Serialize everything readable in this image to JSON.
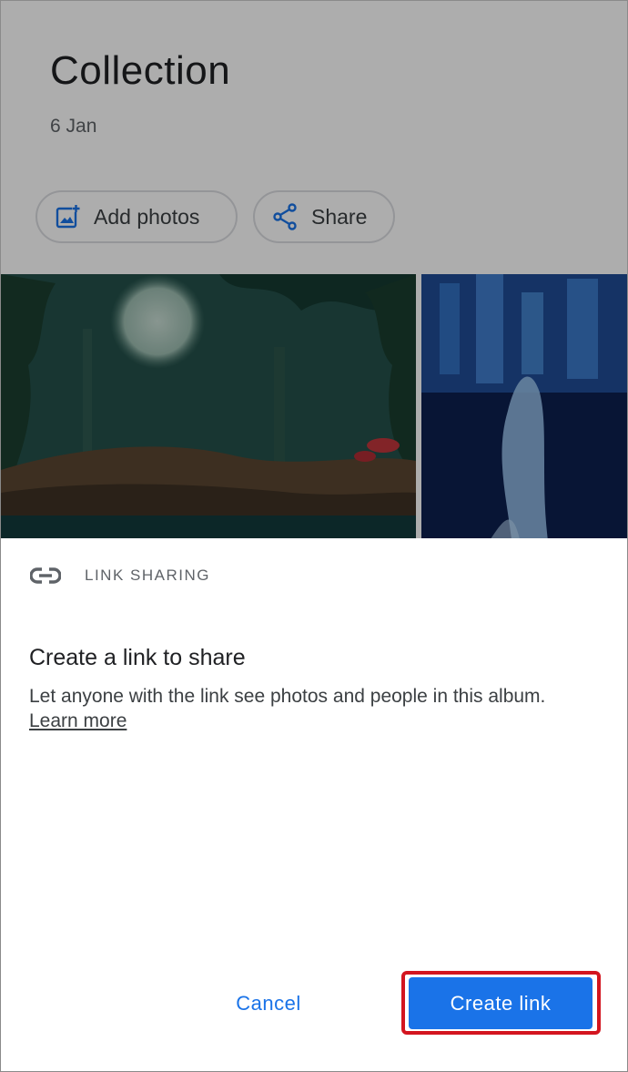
{
  "album": {
    "title": "Collection",
    "date": "6 Jan",
    "actions": {
      "add_photos": {
        "label": "Add photos",
        "icon": "add-photo-icon"
      },
      "share": {
        "label": "Share",
        "icon": "share-icon"
      }
    },
    "photos": [
      {
        "description_icon": "forest-photo"
      },
      {
        "description_icon": "fountain-photo"
      }
    ]
  },
  "sheet": {
    "header": {
      "icon": "link-icon",
      "label": "LINK SHARING"
    },
    "title": "Create a link to share",
    "description": "Let anyone with the link see photos and people in this album.",
    "learn_more": "Learn more",
    "buttons": {
      "cancel": "Cancel",
      "create_link": "Create link"
    }
  },
  "colors": {
    "accent": "#1a73e8",
    "highlight": "#d3151f",
    "text_primary": "#202124",
    "text_secondary": "#5f6368"
  }
}
